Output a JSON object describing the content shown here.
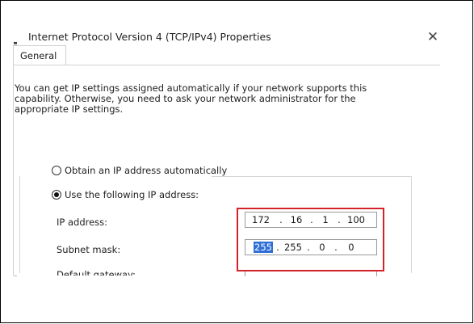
{
  "dialog": {
    "title": "Internet Protocol Version 4 (TCP/IPv4) Properties",
    "close_icon": "close-icon"
  },
  "tabs": [
    {
      "label": "General"
    }
  ],
  "intro_text": "You can get IP settings assigned automatically if your network supports this capability. Otherwise, you need to ask your network administrator for the appropriate IP settings.",
  "options": {
    "auto_label": "Obtain an IP address automatically",
    "manual_label": "Use the following IP address:",
    "selected": "manual"
  },
  "fields": {
    "ip_label": "IP address:",
    "ip_octets": [
      "172",
      "16",
      "1",
      "100"
    ],
    "subnet_label": "Subnet mask:",
    "subnet_octets": [
      "255",
      "255",
      "0",
      "0"
    ],
    "gateway_label": "Default gateway:"
  },
  "colors": {
    "highlight": "#d2232a",
    "selection": "#2f6fd6"
  }
}
